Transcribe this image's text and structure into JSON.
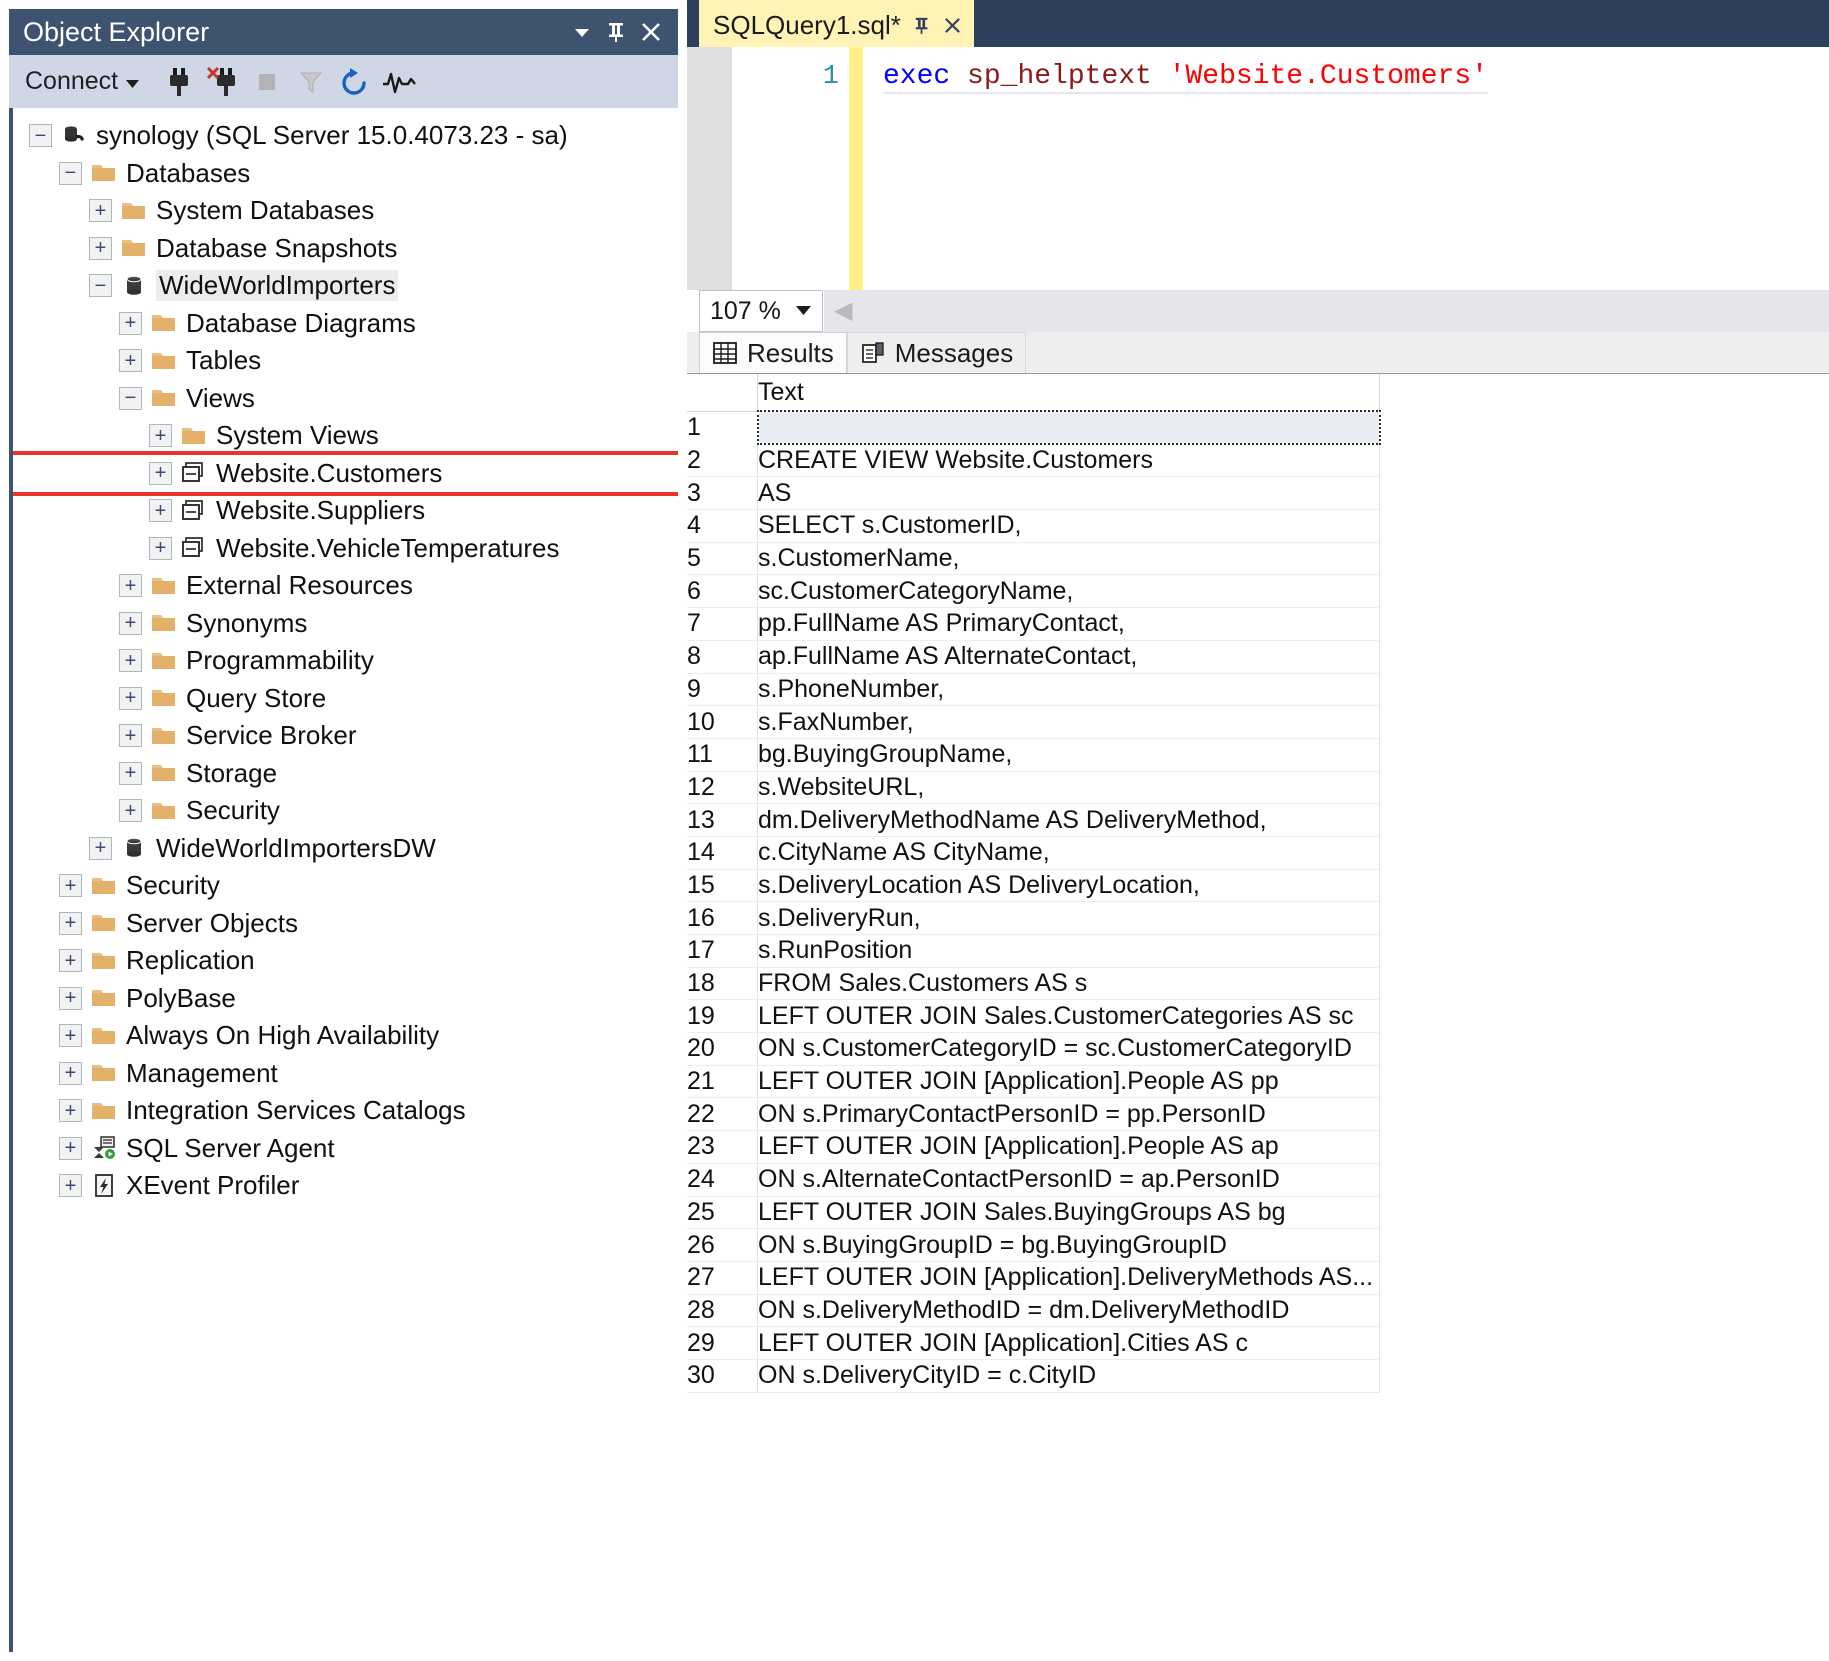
{
  "object_explorer": {
    "title": "Object Explorer",
    "title_buttons": [
      {
        "name": "window-dropdown-icon",
        "glyph": "▼"
      },
      {
        "name": "pin-icon",
        "glyph": "⚐"
      },
      {
        "name": "close-icon",
        "glyph": "✕"
      }
    ],
    "toolbar": {
      "connect_label": "Connect",
      "connect_caret": "▾",
      "buttons": [
        {
          "name": "connect-object-explorer-icon",
          "title": "Connect"
        },
        {
          "name": "disconnect-object-explorer-icon",
          "title": "Disconnect"
        },
        {
          "name": "stop-icon",
          "title": "Stop"
        },
        {
          "name": "filter-icon",
          "title": "Filter"
        },
        {
          "name": "refresh-icon",
          "title": "Refresh"
        },
        {
          "name": "activity-monitor-icon",
          "title": "Activity Monitor"
        }
      ]
    },
    "tree": [
      {
        "label": "synology (SQL Server 15.0.4073.23 - sa)",
        "depth": 0,
        "state": "minus",
        "icon": "server-icon"
      },
      {
        "label": "Databases",
        "depth": 1,
        "state": "minus",
        "icon": "folder-icon"
      },
      {
        "label": "System Databases",
        "depth": 2,
        "state": "plus",
        "icon": "folder-icon"
      },
      {
        "label": "Database Snapshots",
        "depth": 2,
        "state": "plus",
        "icon": "folder-icon"
      },
      {
        "label": "WideWorldImporters",
        "depth": 2,
        "state": "minus",
        "icon": "database-icon",
        "selected": true
      },
      {
        "label": "Database Diagrams",
        "depth": 3,
        "state": "plus",
        "icon": "folder-icon"
      },
      {
        "label": "Tables",
        "depth": 3,
        "state": "plus",
        "icon": "folder-icon"
      },
      {
        "label": "Views",
        "depth": 3,
        "state": "minus",
        "icon": "folder-icon"
      },
      {
        "label": "System Views",
        "depth": 4,
        "state": "plus",
        "icon": "folder-icon"
      },
      {
        "label": "Website.Customers",
        "depth": 4,
        "state": "plus",
        "icon": "view-icon",
        "highlight": true
      },
      {
        "label": "Website.Suppliers",
        "depth": 4,
        "state": "plus",
        "icon": "view-icon"
      },
      {
        "label": "Website.VehicleTemperatures",
        "depth": 4,
        "state": "plus",
        "icon": "view-icon"
      },
      {
        "label": "External Resources",
        "depth": 3,
        "state": "plus",
        "icon": "folder-icon"
      },
      {
        "label": "Synonyms",
        "depth": 3,
        "state": "plus",
        "icon": "folder-icon"
      },
      {
        "label": "Programmability",
        "depth": 3,
        "state": "plus",
        "icon": "folder-icon"
      },
      {
        "label": "Query Store",
        "depth": 3,
        "state": "plus",
        "icon": "folder-icon"
      },
      {
        "label": "Service Broker",
        "depth": 3,
        "state": "plus",
        "icon": "folder-icon"
      },
      {
        "label": "Storage",
        "depth": 3,
        "state": "plus",
        "icon": "folder-icon"
      },
      {
        "label": "Security",
        "depth": 3,
        "state": "plus",
        "icon": "folder-icon"
      },
      {
        "label": "WideWorldImportersDW",
        "depth": 2,
        "state": "plus",
        "icon": "database-icon"
      },
      {
        "label": "Security",
        "depth": 1,
        "state": "plus",
        "icon": "folder-icon"
      },
      {
        "label": "Server Objects",
        "depth": 1,
        "state": "plus",
        "icon": "folder-icon"
      },
      {
        "label": "Replication",
        "depth": 1,
        "state": "plus",
        "icon": "folder-icon"
      },
      {
        "label": "PolyBase",
        "depth": 1,
        "state": "plus",
        "icon": "folder-icon"
      },
      {
        "label": "Always On High Availability",
        "depth": 1,
        "state": "plus",
        "icon": "folder-icon"
      },
      {
        "label": "Management",
        "depth": 1,
        "state": "plus",
        "icon": "folder-icon"
      },
      {
        "label": "Integration Services Catalogs",
        "depth": 1,
        "state": "plus",
        "icon": "folder-icon"
      },
      {
        "label": "SQL Server Agent",
        "depth": 1,
        "state": "plus",
        "icon": "agent-icon"
      },
      {
        "label": "XEvent Profiler",
        "depth": 1,
        "state": "plus",
        "icon": "xevent-icon"
      }
    ]
  },
  "editor": {
    "tab_label": "SQLQuery1.sql*",
    "tab_pin_glyph": "⚐",
    "tab_close_glyph": "✕",
    "line_number": "1",
    "code": {
      "keyword": "exec",
      "procedure": "sp_helptext",
      "string": "'Website.Customers'"
    }
  },
  "results_toolbar": {
    "zoom_value": "107 %",
    "zoom_caret": "▼",
    "scroll_left_glyph": "◀"
  },
  "results_tabs": [
    {
      "label": "Results",
      "icon": "grid-icon",
      "active": true
    },
    {
      "label": "Messages",
      "icon": "message-icon",
      "active": false
    }
  ],
  "grid": {
    "columns": [
      "",
      "Text"
    ],
    "rows": [
      {
        "n": "1",
        "text": "",
        "selected": true
      },
      {
        "n": "2",
        "text": "CREATE VIEW Website.Customers"
      },
      {
        "n": "3",
        "text": "AS"
      },
      {
        "n": "4",
        "text": "SELECT s.CustomerID,"
      },
      {
        "n": "5",
        "text": "    s.CustomerName,"
      },
      {
        "n": "6",
        "text": "    sc.CustomerCategoryName,"
      },
      {
        "n": "7",
        "text": "    pp.FullName AS PrimaryContact,"
      },
      {
        "n": "8",
        "text": "    ap.FullName AS AlternateContact,"
      },
      {
        "n": "9",
        "text": "    s.PhoneNumber,"
      },
      {
        "n": "10",
        "text": "    s.FaxNumber,"
      },
      {
        "n": "11",
        "text": "    bg.BuyingGroupName,"
      },
      {
        "n": "12",
        "text": "    s.WebsiteURL,"
      },
      {
        "n": "13",
        "text": "    dm.DeliveryMethodName AS DeliveryMethod,"
      },
      {
        "n": "14",
        "text": "    c.CityName AS CityName,"
      },
      {
        "n": "15",
        "text": "    s.DeliveryLocation AS DeliveryLocation,"
      },
      {
        "n": "16",
        "text": "    s.DeliveryRun,"
      },
      {
        "n": "17",
        "text": "    s.RunPosition"
      },
      {
        "n": "18",
        "text": "FROM Sales.Customers AS s"
      },
      {
        "n": "19",
        "text": "LEFT OUTER JOIN Sales.CustomerCategories AS sc"
      },
      {
        "n": "20",
        "text": "ON s.CustomerCategoryID = sc.CustomerCategoryID"
      },
      {
        "n": "21",
        "text": "LEFT OUTER JOIN [Application].People AS pp"
      },
      {
        "n": "22",
        "text": "ON s.PrimaryContactPersonID = pp.PersonID"
      },
      {
        "n": "23",
        "text": "LEFT OUTER JOIN [Application].People AS ap"
      },
      {
        "n": "24",
        "text": "ON s.AlternateContactPersonID = ap.PersonID"
      },
      {
        "n": "25",
        "text": "LEFT OUTER JOIN Sales.BuyingGroups AS bg"
      },
      {
        "n": "26",
        "text": "ON s.BuyingGroupID = bg.BuyingGroupID"
      },
      {
        "n": "27",
        "text": "LEFT OUTER JOIN [Application].DeliveryMethods AS..."
      },
      {
        "n": "28",
        "text": "ON s.DeliveryMethodID = dm.DeliveryMethodID"
      },
      {
        "n": "29",
        "text": "LEFT OUTER JOIN [Application].Cities AS c"
      },
      {
        "n": "30",
        "text": "ON s.DeliveryCityID = c.CityID"
      }
    ]
  },
  "colors": {
    "titlebar": "#3e5370",
    "toolbar": "#cfd6e6",
    "tab_active": "#fff4b5",
    "tabstrip": "#2d3f5a",
    "highlight_border": "#e8352b",
    "row_selected": "#e7edf2",
    "keyword": "#0000ff",
    "procedure": "#8b1a1a",
    "string": "#ff0000",
    "linenum": "#2b91af"
  }
}
